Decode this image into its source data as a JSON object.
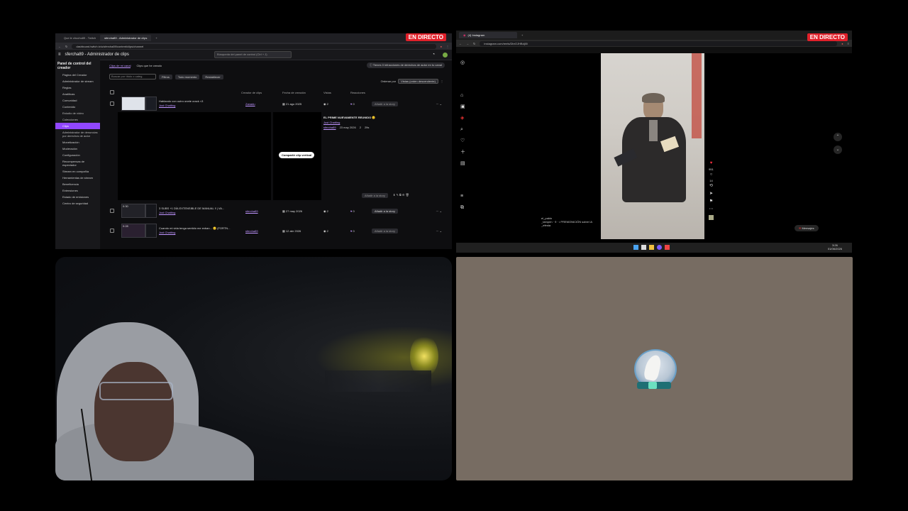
{
  "live_badge": "EN DIRECTO",
  "twitch": {
    "tabs": [
      "Que le chucho89 - Twitch",
      "sfercha89 - Administrador de clips",
      "+"
    ],
    "url": "dashboard.twitch.tv/u/sfercha89/content/clips/channel",
    "header_title": "sfercha89 - Administrador de clips",
    "search_placeholder": "Búsqueda del panel de control (Ctrl + J)",
    "sidebar": {
      "title": "Panel de control del creador",
      "items": [
        {
          "label": "Página del Creador",
          "sub": false,
          "active": false
        },
        {
          "label": "Administrador de stream",
          "sub": false,
          "active": false
        },
        {
          "label": "Reglas",
          "sub": false,
          "active": false
        },
        {
          "label": "Analíticas",
          "sub": false,
          "active": false
        },
        {
          "label": "Comunidad",
          "sub": false,
          "active": false
        },
        {
          "label": "Contenido",
          "sub": false,
          "active": false
        },
        {
          "label": "Estudio de vídeo",
          "sub": true,
          "active": false
        },
        {
          "label": "Colecciones",
          "sub": true,
          "active": false
        },
        {
          "label": "Clips",
          "sub": true,
          "active": true
        },
        {
          "label": "Administrador de denuncias por derechos de autor",
          "sub": true,
          "active": false
        },
        {
          "label": "Monetización",
          "sub": false,
          "active": false
        },
        {
          "label": "Moderación",
          "sub": false,
          "active": false
        },
        {
          "label": "Configuración",
          "sub": false,
          "active": false
        },
        {
          "label": "Recompensas de espectador",
          "sub": false,
          "active": false
        },
        {
          "label": "Stream en compañía",
          "sub": false,
          "active": false
        },
        {
          "label": "Herramientas de stream",
          "sub": false,
          "active": false
        },
        {
          "label": "Beneficencia",
          "sub": false,
          "active": false
        },
        {
          "label": "Extensiones",
          "sub": false,
          "active": false
        },
        {
          "label": "Estado de emisiones",
          "sub": false,
          "active": false
        },
        {
          "label": "Centro de seguridad",
          "sub": false,
          "active": false
        }
      ]
    },
    "content_tabs": [
      "Clips de mi canal",
      "Clips que he creado"
    ],
    "notice": "Tienes 0 infracciones de derechos de autor en tu canal",
    "filter_placeholder": "Buscar por título o categ.",
    "filter_buttons": [
      "Filtros",
      "Todo momento",
      "Restablecer"
    ],
    "sort_label": "Ordenar por",
    "sort_value": "Vistas (orden descendente)",
    "columns": [
      "Creador de clips",
      "Fecha de creación",
      "Vistas",
      "Reacciones"
    ],
    "rows": [
      {
        "title": "Hablando con outro onete crack <3",
        "category": "Just Chatting",
        "creator": "Zanadu",
        "date": "21 ago 2025",
        "views": "2",
        "reactions": "0",
        "action": "Añadir a la story",
        "duration": ""
      },
      {
        "title": "3 SUBS +1 DÍA EXTENSIBLE DE MANUAL ‼ | VA...",
        "category": "Just Chatting",
        "creator": "sfercha89",
        "date": "27 may 2026",
        "views": "2",
        "reactions": "0",
        "action": "Añadir a la story",
        "duration": "0:30"
      },
      {
        "title": "Cuando mi vida tenga sentido me exban... 😐 (FORTN...",
        "category": "Just Chatting",
        "creator": "sfercha89",
        "date": "12 abr 2026",
        "views": "2",
        "reactions": "0",
        "action": "Añadir a la story",
        "duration": "0:28"
      }
    ],
    "expanded": {
      "title": "EL PRIME NUEVAMENTE REUNIDO 😐",
      "category": "Just Chatting",
      "creator": "sfercha89",
      "date": "23 may 2026",
      "views": "2",
      "duration": "29s",
      "share_label": "Compartir clip vertical",
      "story_label": "Añadir a la story"
    }
  },
  "instagram": {
    "tab_label": "(4) Instagram",
    "url": "instagram.com/reels/DbrOJHBdjI0/",
    "comment_user": "el_pabin",
    "comment_lines": [
      "_tampen · 9 · • PREMONICIÓN sobre IA",
      "_efesta"
    ],
    "messages_label": "Mensajes",
    "likes": "951",
    "comments_count": "14"
  },
  "taskbar": {
    "time": "3:26",
    "date": "01/06/2026"
  },
  "colors": {
    "live": "#e0202a",
    "twitch_purple": "#9147ff",
    "placeholder_bg": "#776c62"
  }
}
